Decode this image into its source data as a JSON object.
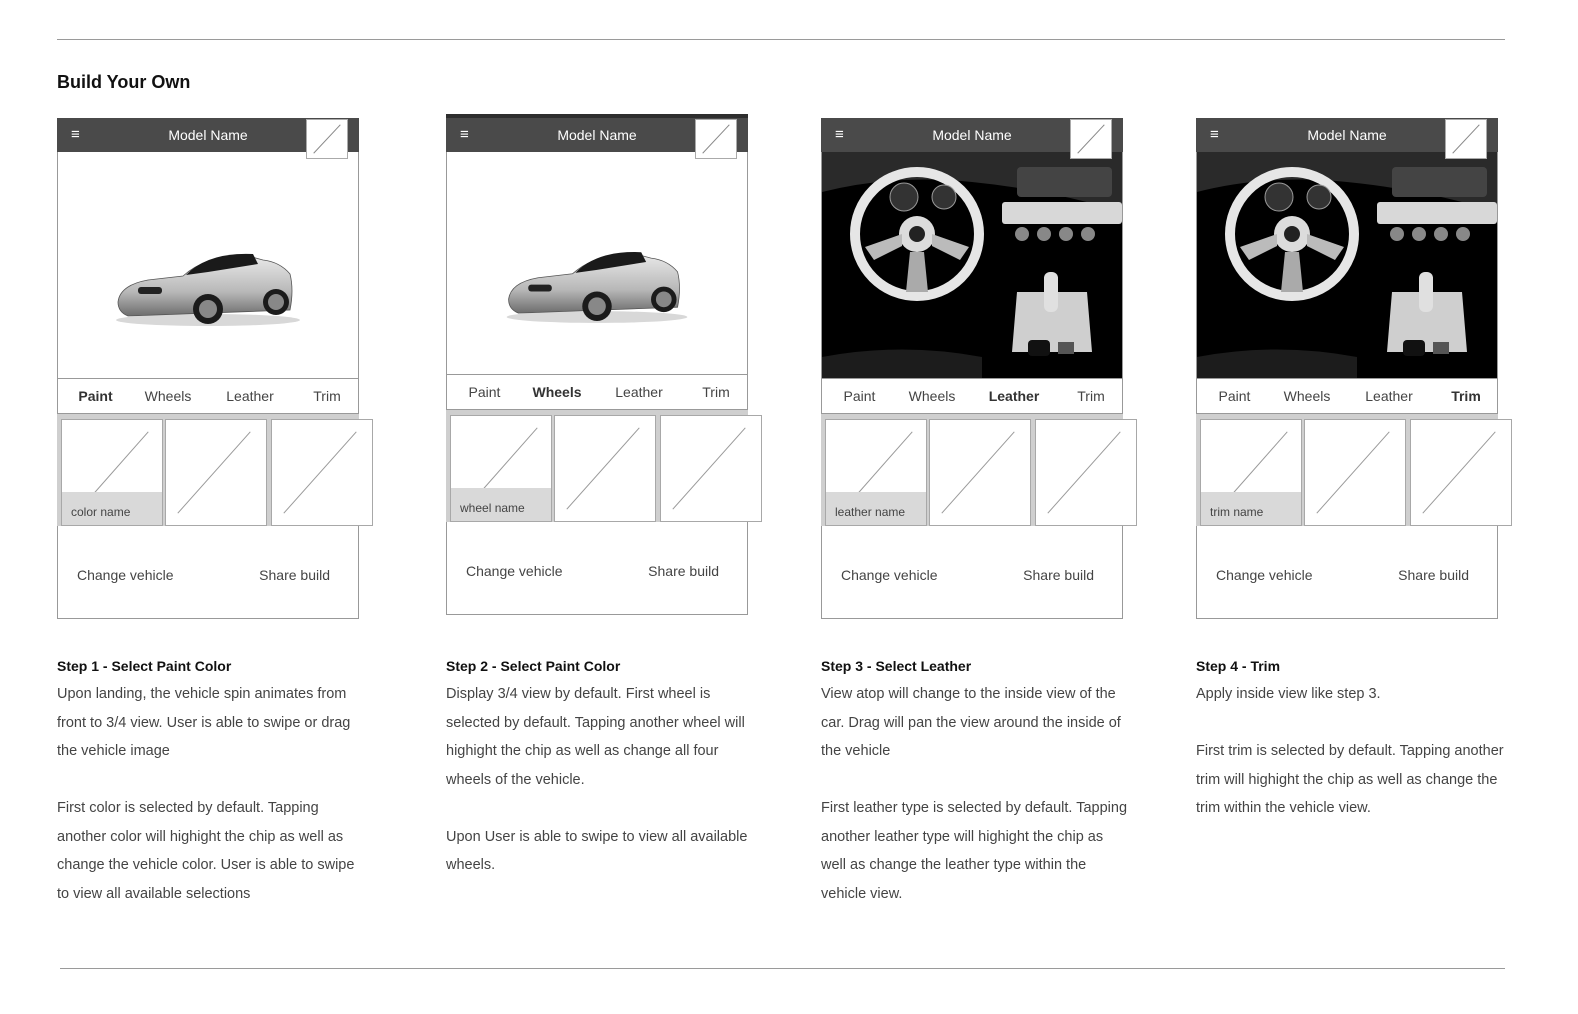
{
  "page": {
    "title": "Build Your Own"
  },
  "panels": [
    {
      "header": {
        "menu_icon": "≡",
        "model_name": "Model Name"
      },
      "view": "exterior",
      "tabs": [
        {
          "label": "Paint",
          "active": true
        },
        {
          "label": "Wheels",
          "active": false
        },
        {
          "label": "Leather",
          "active": false
        },
        {
          "label": "Trim",
          "active": false
        }
      ],
      "chip_label": "color name",
      "footer": {
        "change_vehicle": "Change vehicle",
        "share_build": "Share build"
      },
      "step": {
        "title": "Step 1 - Select Paint Color",
        "para1": [
          "Upon landing, the vehicle spin animates from",
          "front to 3/4 view. User is able to swipe or drag",
          "the vehicle image"
        ],
        "para2": [
          "First color is selected by default. Tapping",
          "another color will highight the chip as well as",
          "change the vehicle color. User is able to swipe",
          "to view all available selections"
        ]
      }
    },
    {
      "header": {
        "menu_icon": "≡",
        "model_name": "Model Name"
      },
      "view": "exterior",
      "tabs": [
        {
          "label": "Paint",
          "active": false
        },
        {
          "label": "Wheels",
          "active": true
        },
        {
          "label": "Leather",
          "active": false
        },
        {
          "label": "Trim",
          "active": false
        }
      ],
      "chip_label": "wheel name",
      "footer": {
        "change_vehicle": "Change vehicle",
        "share_build": "Share build"
      },
      "step": {
        "title": "Step 2 - Select Paint Color",
        "para1": [
          "Display 3/4 view by default. First wheel is",
          "selected by default. Tapping another wheel will",
          "highight the chip as well as change all four",
          "wheels of the vehicle."
        ],
        "para2": [
          "Upon User is able to swipe to view all available",
          "wheels."
        ]
      }
    },
    {
      "header": {
        "menu_icon": "≡",
        "model_name": "Model Name"
      },
      "view": "interior",
      "tabs": [
        {
          "label": "Paint",
          "active": false
        },
        {
          "label": "Wheels",
          "active": false
        },
        {
          "label": "Leather",
          "active": true
        },
        {
          "label": "Trim",
          "active": false
        }
      ],
      "chip_label": "leather name",
      "footer": {
        "change_vehicle": "Change vehicle",
        "share_build": "Share build"
      },
      "step": {
        "title": "Step 3 - Select Leather",
        "para1": [
          "View atop will change to the inside view of the",
          "car. Drag will pan the view around the inside of",
          "the vehicle"
        ],
        "para2": [
          "First leather type is selected by default. Tapping",
          "another leather type will highight the chip as",
          "well as change the leather type within the",
          "vehicle view."
        ]
      }
    },
    {
      "header": {
        "menu_icon": "≡",
        "model_name": "Model Name"
      },
      "view": "interior",
      "tabs": [
        {
          "label": "Paint",
          "active": false
        },
        {
          "label": "Wheels",
          "active": false
        },
        {
          "label": "Leather",
          "active": false
        },
        {
          "label": "Trim",
          "active": true
        }
      ],
      "chip_label": "trim name",
      "footer": {
        "change_vehicle": "Change vehicle",
        "share_build": "Share build"
      },
      "step": {
        "title": "Step 4 - Trim",
        "para1": [
          "Apply inside view like step 3."
        ],
        "para2": [
          "First trim is selected by default. Tapping another",
          "trim will highight the chip as well as change the",
          "trim within the vehicle view."
        ]
      }
    }
  ]
}
